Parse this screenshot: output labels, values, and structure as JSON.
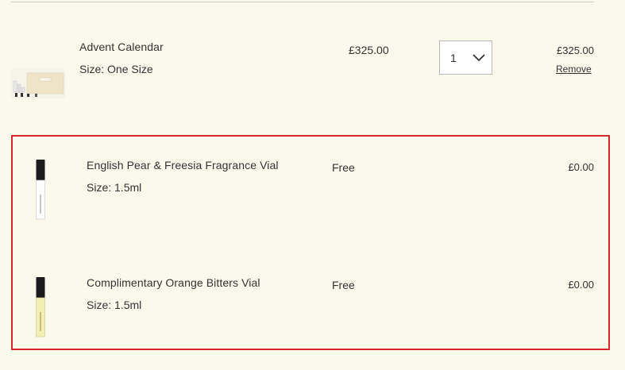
{
  "cart": {
    "items": [
      {
        "name": "Advent Calendar",
        "size": "Size: One Size",
        "price": "£325.00",
        "quantity": "1",
        "total": "£325.00",
        "remove_label": "Remove"
      },
      {
        "name": "English Pear & Freesia Fragrance Vial",
        "size": "Size: 1.5ml",
        "price": "Free",
        "total": "£0.00"
      },
      {
        "name": "Complimentary Orange Bitters Vial",
        "size": "Size: 1.5ml",
        "price": "Free",
        "total": "£0.00"
      }
    ]
  },
  "colors": {
    "background": "#fbf9ec",
    "highlight_border": "#d9272e"
  }
}
